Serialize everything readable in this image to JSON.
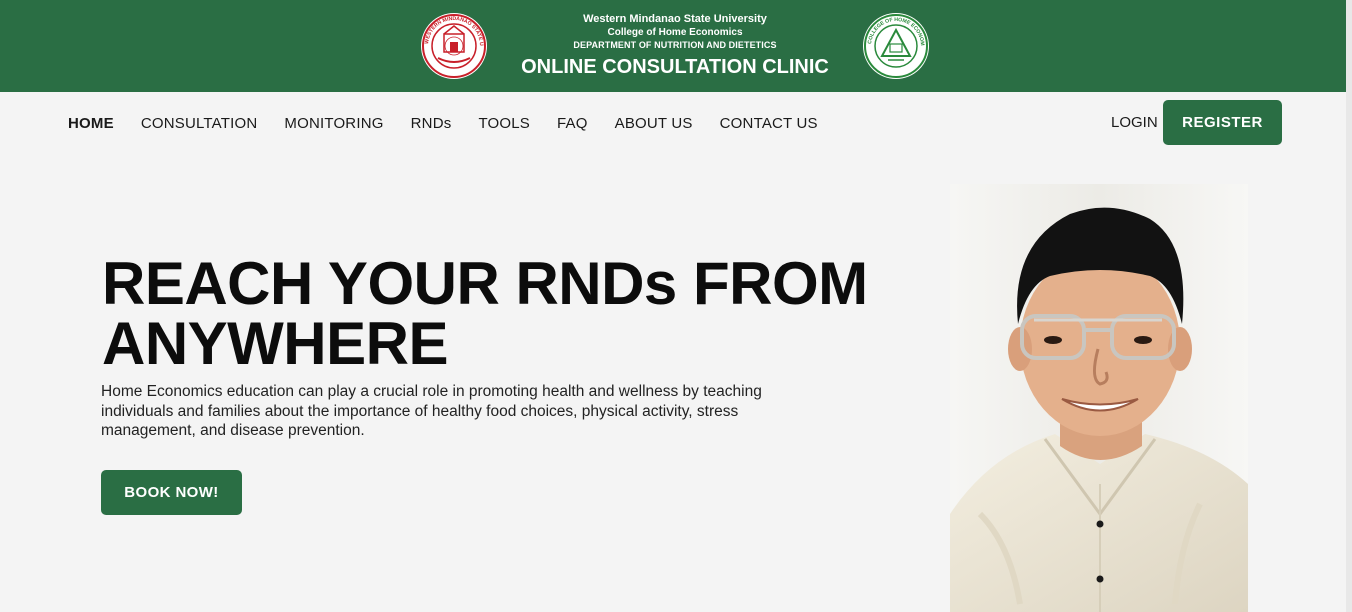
{
  "banner": {
    "university": "Western Mindanao State University",
    "college": "College of Home Economics",
    "department": "DEPARTMENT OF NUTRITION AND DIETETICS",
    "title": "ONLINE CONSULTATION CLINIC",
    "left_seal_icon": "wmsu-seal-icon",
    "right_seal_icon": "college-of-home-economics-seal-icon",
    "left_seal_text": "WESTERN MINDANAO STATE UNIVERSITY",
    "right_seal_text": "COLLEGE OF HOME ECONOMICS · WMSU ·",
    "colors": {
      "brand_green": "#2a6e44",
      "seal_red": "#c8202a",
      "seal_green": "#2a8a3c"
    }
  },
  "nav": {
    "items": [
      {
        "label": "HOME",
        "active": true
      },
      {
        "label": "CONSULTATION",
        "active": false
      },
      {
        "label": "MONITORING",
        "active": false
      },
      {
        "label": "RNDs",
        "active": false
      },
      {
        "label": "TOOLS",
        "active": false
      },
      {
        "label": "FAQ",
        "active": false
      },
      {
        "label": "ABOUT US",
        "active": false
      },
      {
        "label": "CONTACT US",
        "active": false
      }
    ],
    "login_label": "LOGIN",
    "register_label": "REGISTER"
  },
  "hero": {
    "title": "REACH YOUR RNDs FROM ANYWHERE",
    "description": "Home Economics education can play a crucial role in promoting health and wellness by teaching individuals and families about the importance of healthy food choices, physical activity, stress management, and disease prevention.",
    "cta_label": "BOOK NOW!",
    "portrait_icon": "rnd-portrait-photo"
  }
}
